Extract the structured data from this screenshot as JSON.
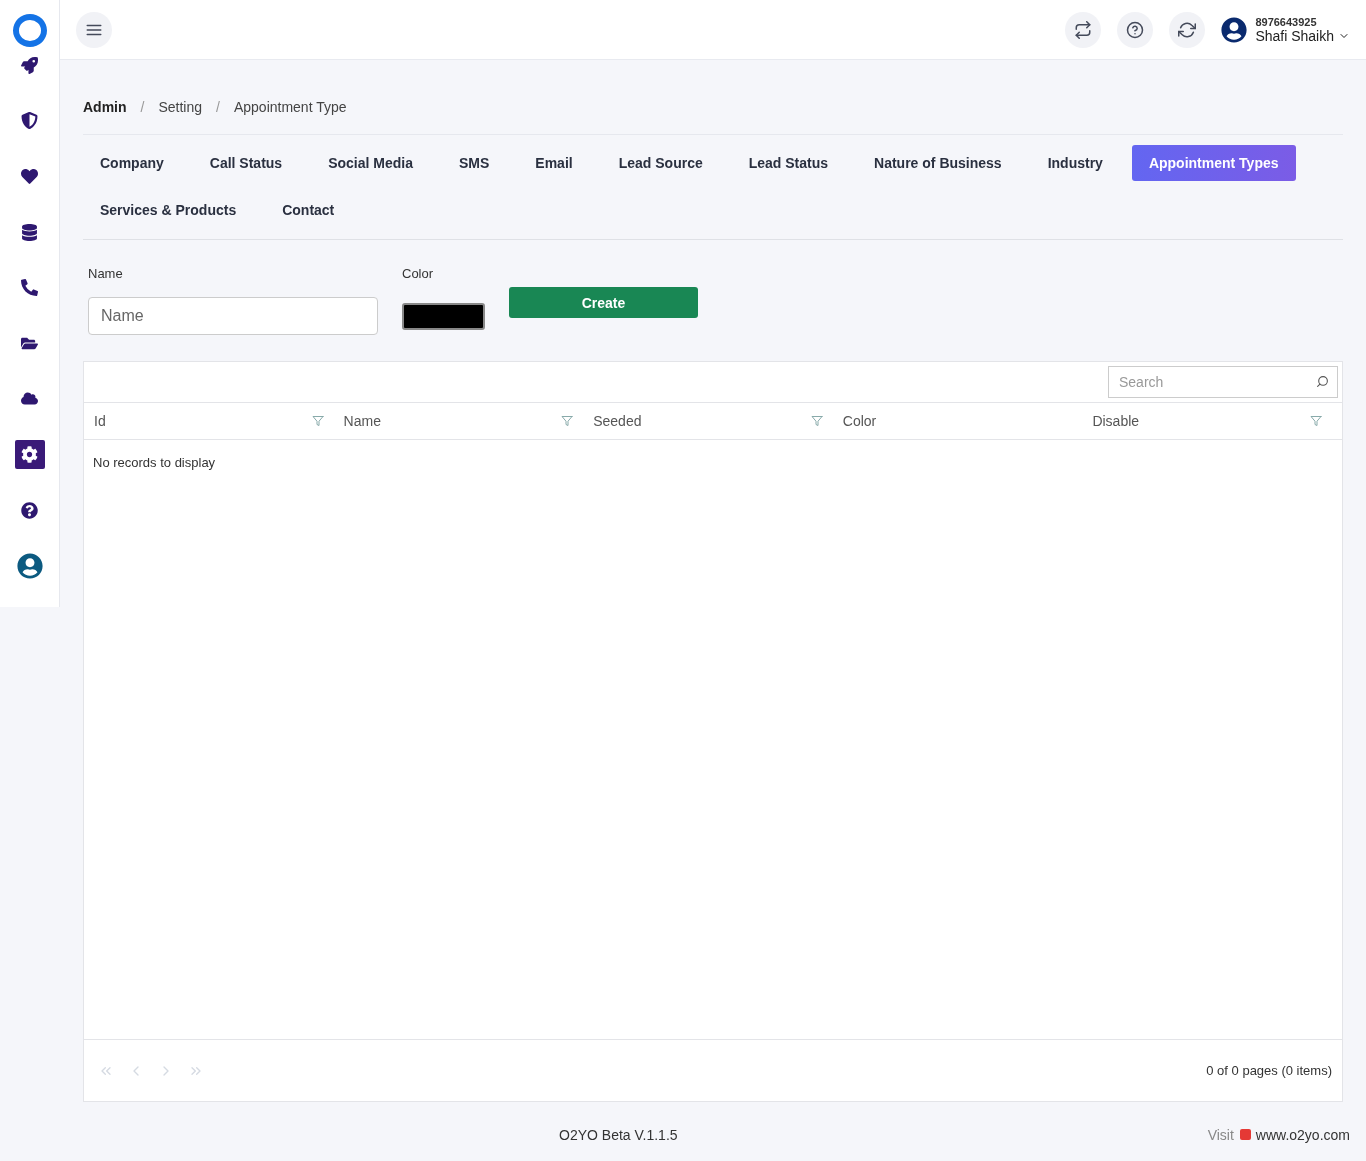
{
  "sidebar": {
    "items": [
      {
        "selected": false
      },
      {
        "selected": false
      },
      {
        "selected": false
      },
      {
        "selected": false
      },
      {
        "selected": false
      },
      {
        "selected": false
      },
      {
        "selected": false
      },
      {
        "selected": true
      },
      {
        "selected": false
      },
      {
        "selected": false
      }
    ]
  },
  "header": {
    "phone": "8976643925",
    "user_name": "Shafi Shaikh"
  },
  "breadcrumb": [
    {
      "kind": "link",
      "text": "Admin"
    },
    {
      "kind": "separator",
      "text": "/"
    },
    {
      "kind": "link",
      "text": "Setting"
    },
    {
      "kind": "separator",
      "text": "/"
    },
    {
      "kind": "current",
      "text": "Appointment Type"
    }
  ],
  "tabs": [
    {
      "label": "Company",
      "selected": false
    },
    {
      "label": "Call Status",
      "selected": false
    },
    {
      "label": "Social Media",
      "selected": false
    },
    {
      "label": "SMS",
      "selected": false
    },
    {
      "label": "Email",
      "selected": false
    },
    {
      "label": "Lead Source",
      "selected": false
    },
    {
      "label": "Lead Status",
      "selected": false
    },
    {
      "label": "Nature of Business",
      "selected": false
    },
    {
      "label": "Industry",
      "selected": false
    },
    {
      "label": "Appointment Types",
      "selected": true
    },
    {
      "label": "Services & Products",
      "selected": false
    },
    {
      "label": "Contact",
      "selected": false
    }
  ],
  "form": {
    "name_label": "Name",
    "name_placeholder": "Name",
    "color_label": "Color",
    "color": "#000000",
    "create_button": "Create"
  },
  "table": {
    "search_placeholder": "Search",
    "columns": [
      {
        "label": "Id",
        "filter": true
      },
      {
        "label": "Name",
        "filter": true
      },
      {
        "label": "Seeded",
        "filter": true
      },
      {
        "label": "Color",
        "filter": false
      },
      {
        "label": "Disable",
        "filter": true
      }
    ],
    "empty_text": "No records to display",
    "pager_info": "0 of 0 pages (0 items)"
  },
  "footer": {
    "version": "O2YO Beta V.1.1.5",
    "visit": "Visit",
    "site": "www.o2yo.com"
  }
}
